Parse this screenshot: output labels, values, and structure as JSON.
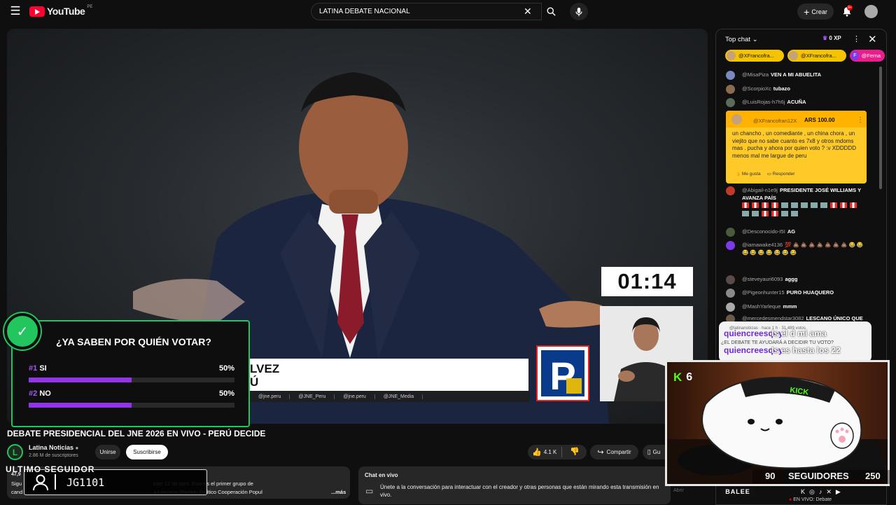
{
  "header": {
    "logo_text": "YouTube",
    "country_code": "PE",
    "search_value": "LATINA DEBATE NACIONAL",
    "create_label": "Crear",
    "notifications_count": "9+"
  },
  "player": {
    "timer": "01:14",
    "lower_third_name": "LVEZ",
    "lower_third_sub": "Ú",
    "social_handles": [
      "@jne.peru",
      "@JNE_Peru",
      "@jne.peru",
      "@JNE_Media"
    ],
    "party_logo_letter": "P"
  },
  "poll": {
    "question": "¿YA SABEN POR QUIÉN VOTAR?",
    "options": [
      {
        "rank": "#1",
        "label": "SI",
        "percent": "50%",
        "value": 0.5
      },
      {
        "rank": "#2",
        "label": "NO",
        "percent": "50%",
        "value": 0.5
      }
    ]
  },
  "video": {
    "title": "DEBATE PRESIDENCIAL DEL JNE 2026 EN VIVO - PERÚ DECIDE",
    "channel_name": "Latina Noticias",
    "channel_initial": "L",
    "subscribers": "2.86 M de suscriptores",
    "join_label": "Unirse",
    "subscribe_label": "Suscribirse",
    "likes": "4.1 K",
    "share_label": "Compartir",
    "save_label": "Gu"
  },
  "description": {
    "views": "47,9",
    "line1": "Sigu                                                                                          este 12 de abril. Este es el primer grupo de",
    "line2": "cand                                                                                          y Lescano (Partido Político Cooperación Popul",
    "more_label": "...más"
  },
  "overlay": {
    "ultimo_label": "ULTIMO SEGUIDOR",
    "ultimo_name": "JG1101",
    "kick_count": "6",
    "followers_current": "90",
    "followers_label": "SEGUIDORES",
    "followers_goal": "250",
    "streamer_name": "BALEE",
    "live_now": "EN VIVO: Debate",
    "abrir": "Abrir"
  },
  "live_chat_box": {
    "title": "Chat en vivo",
    "text": "Únete a la conversación para interactuar con el creador y otras personas que están mirando esta transmisión en vivo."
  },
  "chat": {
    "top_label": "Top chat",
    "xp": "0 XP",
    "pills": [
      "@XFrancofra...",
      "@XFrancofra...",
      "@Ferna"
    ],
    "messages": [
      {
        "user": "@MisaPiza",
        "text": "VEN A MI ABUELITA",
        "color": "#7a88c0"
      },
      {
        "user": "@ScorpioXc",
        "text": "tubazo",
        "color": "#8b6b52"
      },
      {
        "user": "@LuisRojas-h7h6j",
        "text": "ACUÑA",
        "color": "#5a6b5a"
      }
    ],
    "superchat": {
      "user": "@XFrancofran12X",
      "amount": "ARS 100.00",
      "message": "un chancho , un comediante , un china chora , un viejito que no sabe cuanto es 7x8 y otros mdoms mas . pucha y ahora por quien voto ? :v XDDDDD menos mal me largue de peru",
      "like_label": "Me gusta",
      "reply_label": "Responder"
    },
    "messages2": [
      {
        "user": "@Abigail-n1e9j",
        "text": "PRESIDENTE JOSÉ WILLIAMS Y AVANZA PAÍS",
        "color": "#c0392b"
      },
      {
        "user": "@Desconocido-I5I",
        "text": "AG",
        "color": "#4a5a3a"
      },
      {
        "user": "@iamawake4136",
        "text": "💯 💩 💩 💩 💩 💩 💩 💩 😂 😂 😂 😂 😂 😂 😂 😂 😂",
        "color": "#7c3aed"
      },
      {
        "user": "@steveyauri6093",
        "text": "aggg",
        "color": "#5a4a4a"
      },
      {
        "user": "@Pigeonhunter15",
        "text": "PURO HUAQUERO",
        "color": "#8a8a8a"
      },
      {
        "user": "@MashYarleque",
        "text": "mmm",
        "color": "#aaaaaa"
      },
      {
        "user": "@mercedesmendstar3082",
        "text": "LESCANO ÚNICO QUE",
        "color": "#6b5a4a"
      }
    ],
    "overlay_msgs": [
      {
        "user": "quiencreesqoy",
        "text": "Is el d mi ama"
      },
      {
        "user": "quiencreesqoy",
        "text": "Is es hasta los 22"
      }
    ],
    "pinned_meta": "@latinanoticias · hace 1 h · 31.489 votos",
    "pinned_question": "¿EL DEBATE TE AYUDARÁ A DECIDIR TU VOTO?"
  }
}
